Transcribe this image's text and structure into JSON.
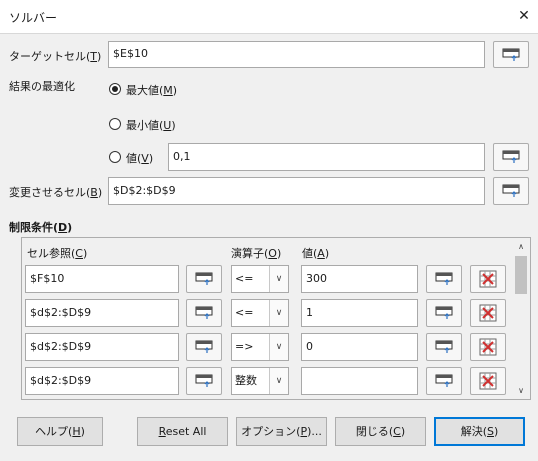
{
  "window": {
    "title": "ソルバー",
    "close_glyph": "✕"
  },
  "target_cell": {
    "label": "ターゲットセル(",
    "accel": "T",
    "label_end": ")",
    "value": "$E$10"
  },
  "optimize": {
    "label": "結果の最適化",
    "options": [
      {
        "label": "最大値(",
        "accel": "M",
        "end": ")",
        "selected": true
      },
      {
        "label": "最小値(",
        "accel": "U",
        "end": ")",
        "selected": false
      },
      {
        "label": "値(",
        "accel": "V",
        "end": ")",
        "selected": false
      }
    ],
    "value_field": "0,1"
  },
  "changing_cells": {
    "label": "変更させるセル(",
    "accel": "B",
    "label_end": ")",
    "value": "$D$2:$D$9"
  },
  "constraints": {
    "label": "制限条件(",
    "accel": "D",
    "label_end": ")",
    "headers": {
      "cell": {
        "label": "セル参照(",
        "accel": "C",
        "end": ")"
      },
      "operator": {
        "label": "演算子(",
        "accel": "O",
        "end": ")"
      },
      "value": {
        "label": "値(",
        "accel": "A",
        "end": ")"
      }
    },
    "rows": [
      {
        "cell": "$F$10",
        "operator": "<=",
        "value": "300"
      },
      {
        "cell": "$d$2:$D$9",
        "operator": "<=",
        "value": "1"
      },
      {
        "cell": "$d$2:$D$9",
        "operator": "=>",
        "value": "0"
      },
      {
        "cell": "$d$2:$D$9",
        "operator": "整数",
        "value": ""
      }
    ]
  },
  "buttons": {
    "help": {
      "label": "ヘルプ(",
      "accel": "H",
      "end": ")"
    },
    "reset": {
      "accel": "R",
      "label": "eset All"
    },
    "options": {
      "label": "オプション(",
      "accel": "P",
      "end": ")..."
    },
    "close": {
      "label": "閉じる(",
      "accel": "C",
      "end": ")"
    },
    "solve": {
      "label": "解決(",
      "accel": "S",
      "end": ")"
    }
  },
  "colors": {
    "accent": "#0078d7",
    "background": "#f0f0f0",
    "shrink_icon": "#2a6fc0",
    "delete_icon": "#d03030"
  }
}
